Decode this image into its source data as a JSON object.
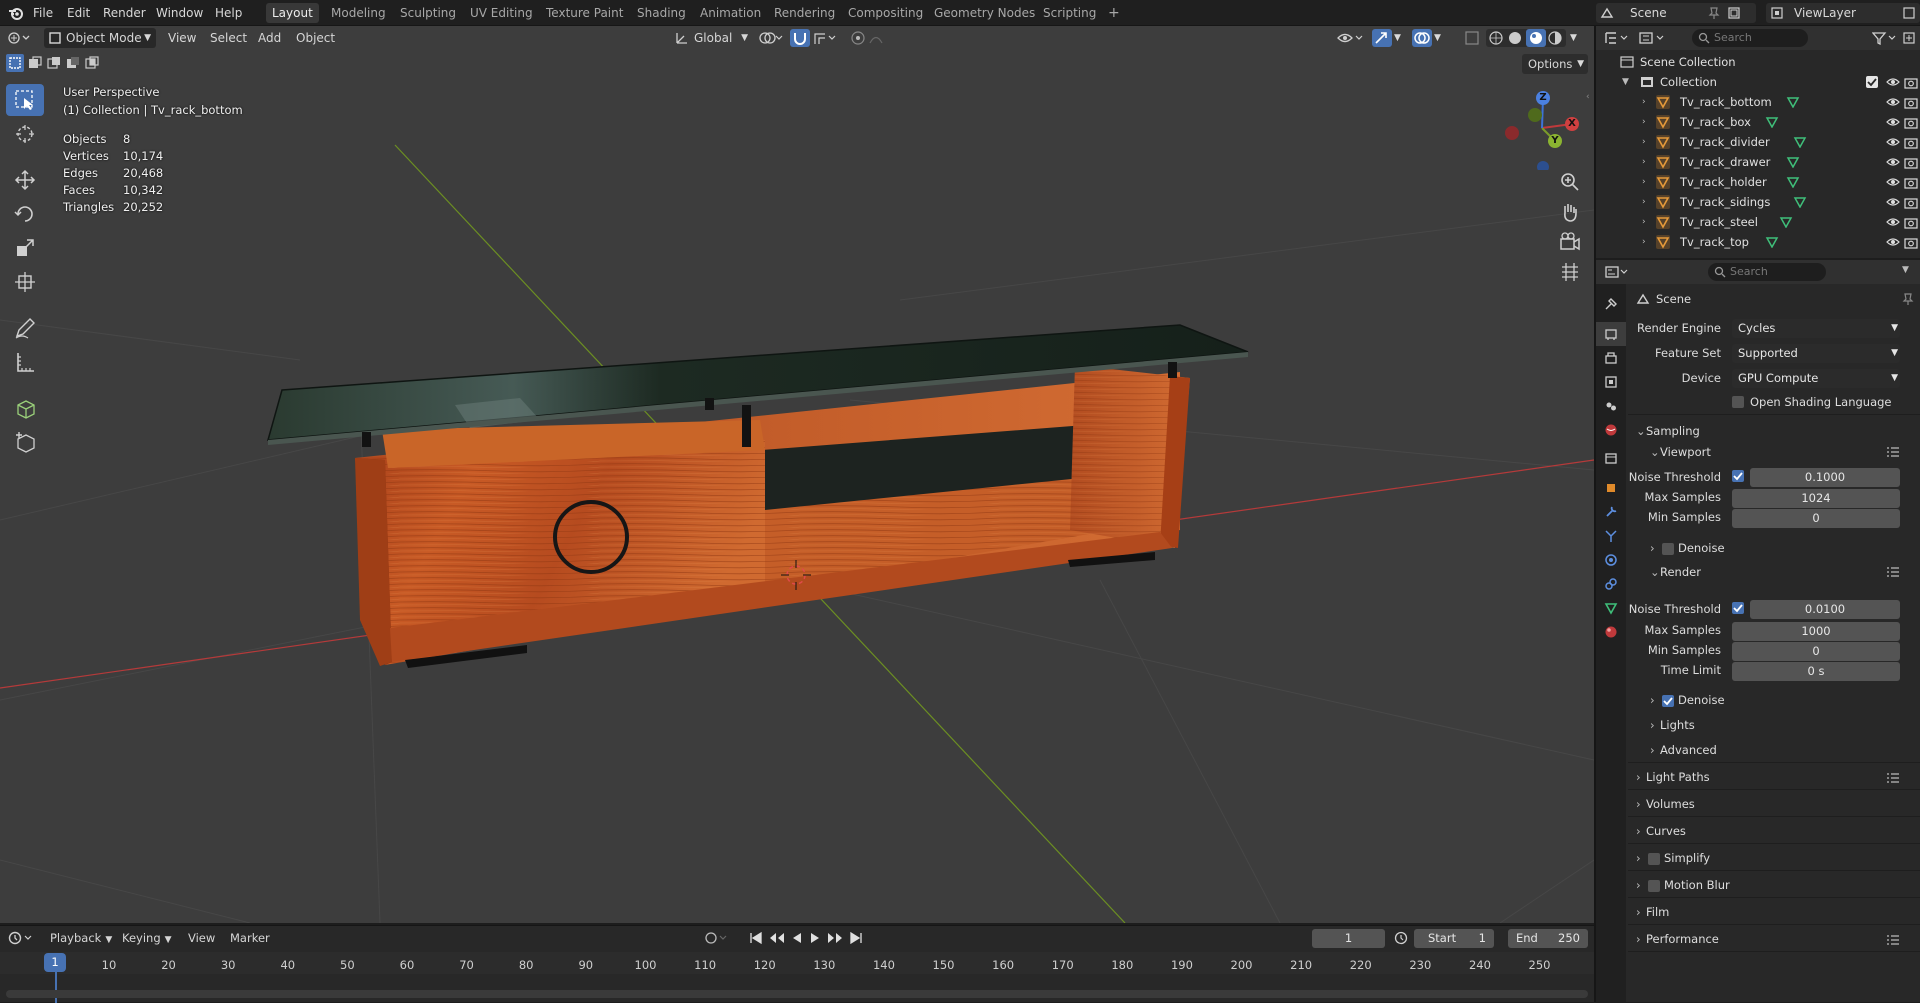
{
  "top_menu": {
    "items": [
      "File",
      "Edit",
      "Render",
      "Window",
      "Help"
    ],
    "workspaces": [
      "Layout",
      "Modeling",
      "Sculpting",
      "UV Editing",
      "Texture Paint",
      "Shading",
      "Animation",
      "Rendering",
      "Compositing",
      "Geometry Nodes",
      "Scripting"
    ],
    "active_workspace": "Layout",
    "add_tab": "+",
    "scene_name": "Scene",
    "view_layer": "ViewLayer"
  },
  "viewport_header": {
    "mode": "Object Mode",
    "menus": [
      "View",
      "Select",
      "Add",
      "Object"
    ],
    "transform_orientation": "Global",
    "options": "Options"
  },
  "viewport_overlay": {
    "perspective": "User Perspective",
    "collection_path": "(1) Collection | Tv_rack_bottom",
    "stats": [
      {
        "label": "Objects",
        "value": "8"
      },
      {
        "label": "Vertices",
        "value": "10,174"
      },
      {
        "label": "Edges",
        "value": "20,468"
      },
      {
        "label": "Faces",
        "value": "10,342"
      },
      {
        "label": "Triangles",
        "value": "20,252"
      }
    ],
    "gizmo_axes": {
      "x": "X",
      "y": "Y",
      "z": "Z"
    }
  },
  "outliner": {
    "search_placeholder": "Search",
    "root": "Scene Collection",
    "collection": "Collection",
    "objects": [
      "Tv_rack_bottom",
      "Tv_rack_box",
      "Tv_rack_divider",
      "Tv_rack_drawer",
      "Tv_rack_holder",
      "Tv_rack_sidings",
      "Tv_rack_steel",
      "Tv_rack_top"
    ]
  },
  "properties": {
    "search_placeholder": "Search",
    "context": "Scene",
    "render_engine_label": "Render Engine",
    "render_engine": "Cycles",
    "feature_set_label": "Feature Set",
    "feature_set": "Supported",
    "device_label": "Device",
    "device": "GPU Compute",
    "osl_label": "Open Shading Language",
    "sampling": "Sampling",
    "viewport": {
      "title": "Viewport",
      "noise_threshold_label": "Noise Threshold",
      "noise_threshold": "0.1000",
      "max_samples_label": "Max Samples",
      "max_samples": "1024",
      "min_samples_label": "Min Samples",
      "min_samples": "0",
      "denoise_label": "Denoise"
    },
    "render": {
      "title": "Render",
      "noise_threshold_label": "Noise Threshold",
      "noise_threshold": "0.0100",
      "max_samples_label": "Max Samples",
      "max_samples": "1000",
      "min_samples_label": "Min Samples",
      "min_samples": "0",
      "time_limit_label": "Time Limit",
      "time_limit": "0 s",
      "denoise_label": "Denoise"
    },
    "subsections": [
      "Lights",
      "Advanced"
    ],
    "panels": [
      "Light Paths",
      "Volumes",
      "Curves",
      "Simplify",
      "Motion Blur",
      "Film",
      "Performance"
    ]
  },
  "timeline": {
    "menus": [
      "Playback",
      "Keying",
      "View",
      "Marker"
    ],
    "current_frame": "1",
    "start_label": "Start",
    "start": "1",
    "end_label": "End",
    "end": "250",
    "ticks": [
      "1",
      "10",
      "20",
      "30",
      "40",
      "50",
      "60",
      "70",
      "80",
      "90",
      "100",
      "110",
      "120",
      "130",
      "140",
      "150",
      "160",
      "170",
      "180",
      "190",
      "200",
      "210",
      "220",
      "230",
      "240",
      "250"
    ]
  },
  "colors": {
    "accent": "#4772b3",
    "wood": "#c2521f",
    "glass": "#1c261e",
    "axis_x": "#c0393b",
    "axis_y": "#7a9b2a",
    "axis_z": "#3d72d6"
  }
}
